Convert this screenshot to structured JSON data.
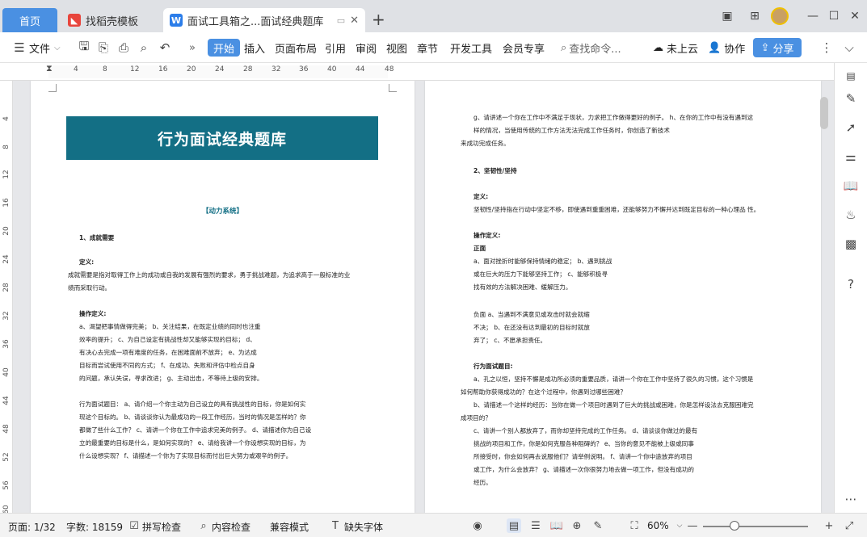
{
  "tabs": {
    "home": "首页",
    "template": "找稻壳模板",
    "doc": "面试工具箱之...面试经典题库",
    "template_icon_color": "#e8453c",
    "doc_icon_color": "#2b7de9"
  },
  "ribbon": {
    "file": "文件",
    "start": "开始",
    "insert": "插入",
    "layout": "页面布局",
    "ref": "引用",
    "review": "审阅",
    "view": "视图",
    "section": "章节",
    "dev": "开发工具",
    "member": "会员专享",
    "search": "查找命令...",
    "cloud": "未上云",
    "collab": "协作",
    "share": "分享",
    "more": "»"
  },
  "ruler_ticks": [
    "4",
    "8",
    "12",
    "16",
    "20",
    "24",
    "28",
    "32",
    "36",
    "40",
    "44",
    "48"
  ],
  "vruler_ticks": [
    "4",
    "8",
    "12",
    "16",
    "20",
    "24",
    "28",
    "32",
    "36",
    "40",
    "44",
    "48",
    "52",
    "56",
    "60"
  ],
  "doc": {
    "title": "行为面试经典题库",
    "category": "【动力系统】",
    "left_lines": [
      "1、成就需要",
      "定义:",
      "成就需要是指对取得工作上的成功或自我的发展有强烈的要求，勇于挑战难题，为追求高于一般标准的业",
      "绩而采取行动。",
      "操作定义:",
      "a、渴望把事情做得完美；  b、关注结果，在既定业绩的同时也注重",
      "效率的提升；  c、为自己设定有挑战性却又能够实现的目标；  d、",
      "有决心去完成一项有难度的任务，在困难面前不放弃；  e、为达成",
      "目标而尝试使用不同的方式；  f、在成功、失败和评估中检点自身",
      "的问题，承认失误，寻求改进；  g、主动出击，不等待上级的安排。",
      "行为面试题目：  a、请介绍一个你主动为自己设立的具有挑战性的目标，你是如何实",
      "现这个目标的。  b、请谈谈你认为最成功的一段工作经历，当时的情况是怎样的？你",
      "都做了些什么工作？  c、请讲一个你在工作中追求完美的例子。  d、请描述你为自己设",
      "立的最重要的目标是什么，是如何实现的？  e、请给我讲一个你设想实现的目标，为",
      "什么设想实现？  f、请描述一个你为了实现目标而付出巨大努力或艰辛的例子。"
    ],
    "right_lines": [
      "g、请讲述一个你在工作中不满足于现状，力求把工作做得更好的例子。  h、在你的工作中有没有遇到这",
      "样的情况，当使用传统的工作方法无法完成工作任务时，你创造了新技术",
      "来成功完成任务。",
      "2、坚韧性/坚持",
      "定义:",
      "坚韧性/坚持指在行动中坚定不移，即使遇到重重困难，还能够努力不懈并达到既定目标的一种心理品 性。",
      "操作定义:",
      "正面",
      "a、面对挫折时能够保持情绪的稳定；  b、遇到挑战",
      "或在巨大的压力下能够坚持工作；  c、能够积极寻",
      "找有效的方法解决困难、缓解压力。",
      "负面 a、当遇到不满意见或攻击时就会就缩",
      "不决；  b、在还没有达到最初的目标时就放",
      "弃了；  c、不愿承担责任。",
      "行为面试题目:",
      "a、孔之以恒，坚持不懈是成功所必须的重要品质，请讲一个你在工作中坚持了很久的习惯，这个习惯是",
      "如何帮助你获得成功的？在这个过程中，你遇到过哪些困难？",
      "b、请描述一个这样的经历：当你在做一个项目时遇到了巨大的挑战或困难，你是怎样设法去克服困难完",
      "成项目的？",
      "c、请讲一个别人都放弃了，而你却坚持完成的工作任务。  d、请谈谈你做过的最有",
      "挑战的项目和工作，你是如何克服各种阻碍的？  e、当你的意见不能被上级或同事",
      "所接受时，你会如何再去说服他们？请举例说明。  f、请讲一个你中途放弃的项目",
      "或工作，为什么会放弃？  g、请描述一次你很努力地去做一项工作，但没有成功的",
      "经历。"
    ]
  },
  "status": {
    "page": "页面: 1/32",
    "words": "字数: 18159",
    "spell": "拼写检查",
    "content": "内容检查",
    "compat": "兼容模式",
    "missing_font": "缺失字体",
    "zoom": "60%",
    "zoom_level_percent": 60
  }
}
